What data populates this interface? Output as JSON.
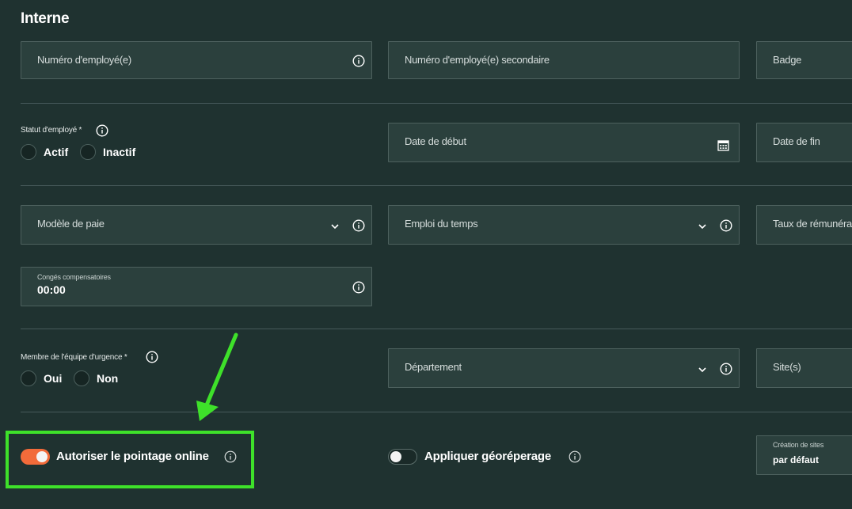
{
  "section": {
    "title": "Interne"
  },
  "row1": {
    "employee_number": "Numéro d'employé(e)",
    "secondary_employee_number": "Numéro d'employé(e) secondaire",
    "badge": "Badge"
  },
  "status": {
    "label": "Statut d'employé *",
    "options": [
      "Actif",
      "Inactif"
    ]
  },
  "dates": {
    "start": "Date de début",
    "end": "Date de fin"
  },
  "pay": {
    "model": "Modèle de paie",
    "schedule": "Emploi du temps",
    "rate": "Taux de rémunéra"
  },
  "leave": {
    "label": "Congés compensatoires",
    "value": "00:00"
  },
  "emergency": {
    "label": "Membre de l'équipe d'urgence *",
    "options": [
      "Oui",
      "Non"
    ]
  },
  "org": {
    "department": "Département",
    "sites": "Site(s)"
  },
  "toggles": {
    "online_punch": {
      "label": "Autoriser le pointage online",
      "on": true
    },
    "geofence": {
      "label": "Appliquer géoréperage",
      "on": false
    }
  },
  "site_creation": {
    "label": "Création de sites",
    "value": "par défaut"
  },
  "colors": {
    "background": "#1f3230",
    "field": "#2b403d",
    "toggle_on": "#f26b3a",
    "highlight": "#3ee12a"
  }
}
